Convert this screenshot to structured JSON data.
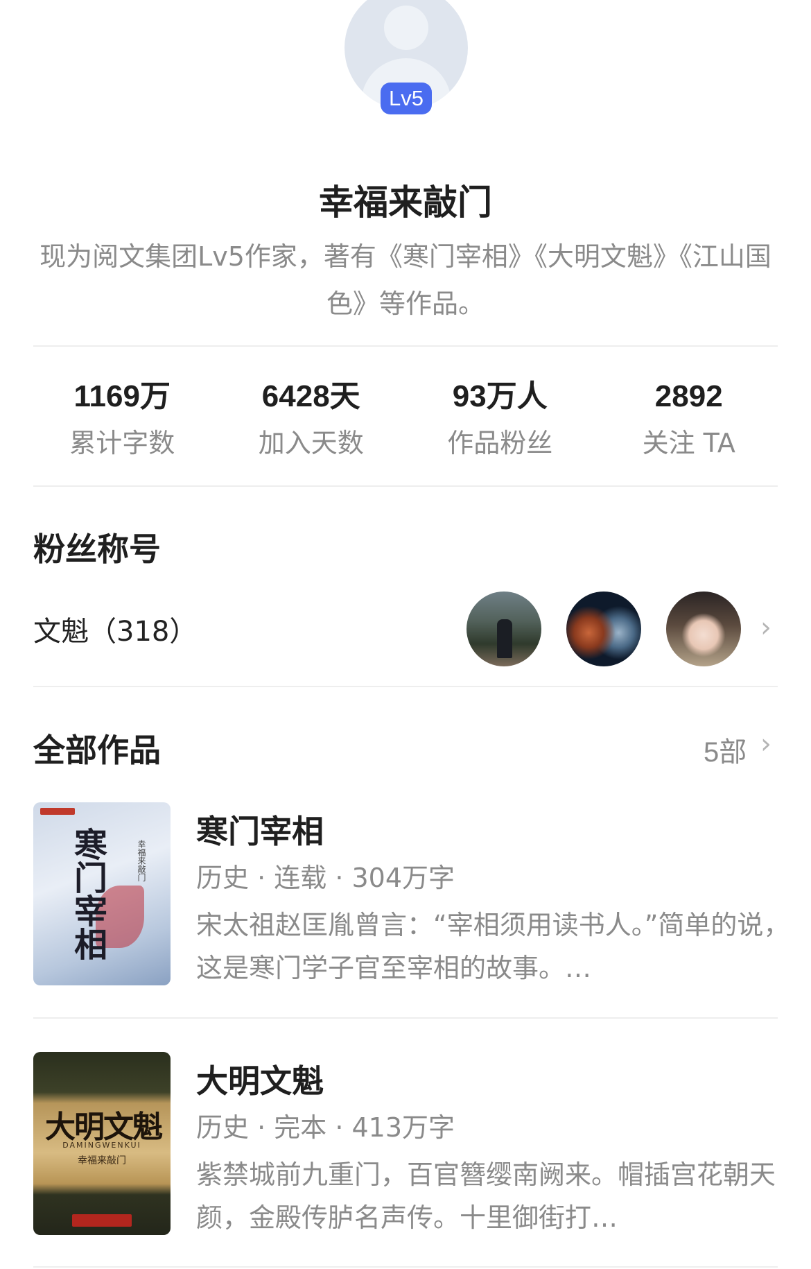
{
  "author": {
    "level_badge": "Lv5",
    "name": "幸福来敲门",
    "bio": "现为阅文集团Lv5作家，著有《寒门宰相》《大明文魁》《江山国色》等作品。"
  },
  "stats": [
    {
      "value": "1169万",
      "label": "累计字数"
    },
    {
      "value": "6428天",
      "label": "加入天数"
    },
    {
      "value": "93万人",
      "label": "作品粉丝"
    },
    {
      "value": "2892",
      "label": "关注 TA"
    }
  ],
  "fan_title": {
    "heading": "粉丝称号",
    "name": "文魁（318）"
  },
  "works": {
    "heading": "全部作品",
    "count": "5部",
    "books": [
      {
        "title": "寒门宰相",
        "meta": "历史 · 连载 · 304万字",
        "description": "宋太祖赵匡胤曾言：“宰相须用读书人。”简单的说，这是寒门学子官至宰相的故事。…",
        "cover_title": "寒门宰相",
        "cover_author": "幸福来敲门"
      },
      {
        "title": "大明文魁",
        "meta": "历史 · 完本 · 413万字",
        "description": "紫禁城前九重门，百官簪缨南阙来。帽插宫花朝天颜，金殿传胪名声传。十里御街打…",
        "cover_title": "大明文魁",
        "cover_subtitle": "DAMINGWENKUI",
        "cover_author": "幸福来敲门"
      }
    ]
  },
  "icons": {
    "chevron": "›"
  },
  "colors": {
    "badge": "#4a6cf0",
    "secondary_text": "#8a8a8a"
  }
}
